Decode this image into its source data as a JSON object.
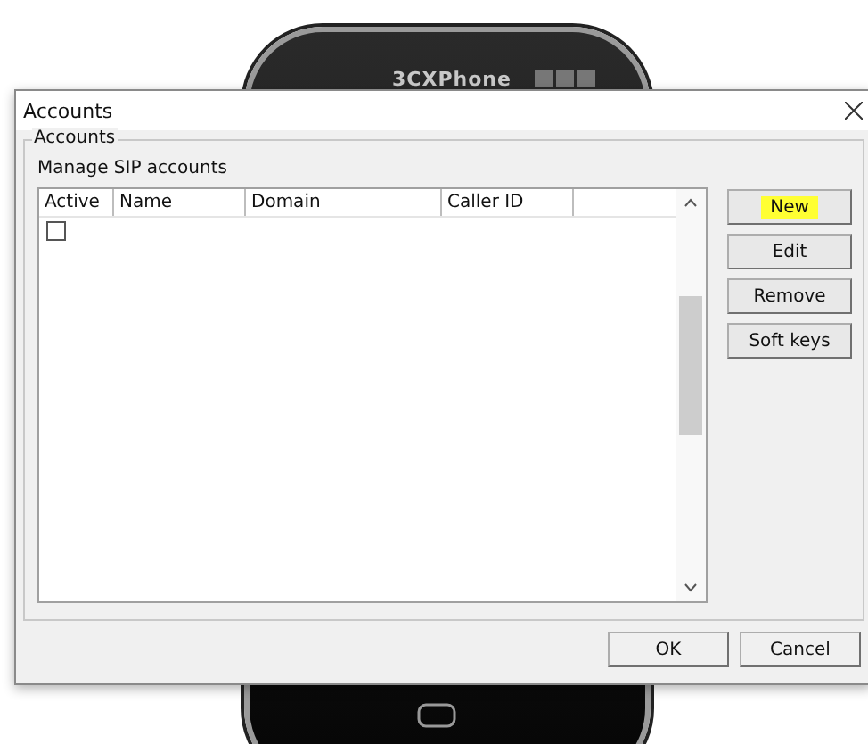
{
  "phone": {
    "title": "3CXPhone"
  },
  "dialog": {
    "title": "Accounts",
    "group_title": "Accounts",
    "description": "Manage SIP accounts",
    "table": {
      "columns": [
        "Active",
        "Name",
        "Domain",
        "Caller ID"
      ],
      "rows": [
        {
          "checked": false
        }
      ]
    },
    "side_buttons": [
      {
        "label": "New",
        "highlighted": true
      },
      {
        "label": "Edit",
        "highlighted": false
      },
      {
        "label": "Remove",
        "highlighted": false
      },
      {
        "label": "Soft keys",
        "highlighted": false
      }
    ],
    "buttons": [
      "OK",
      "Cancel"
    ]
  }
}
